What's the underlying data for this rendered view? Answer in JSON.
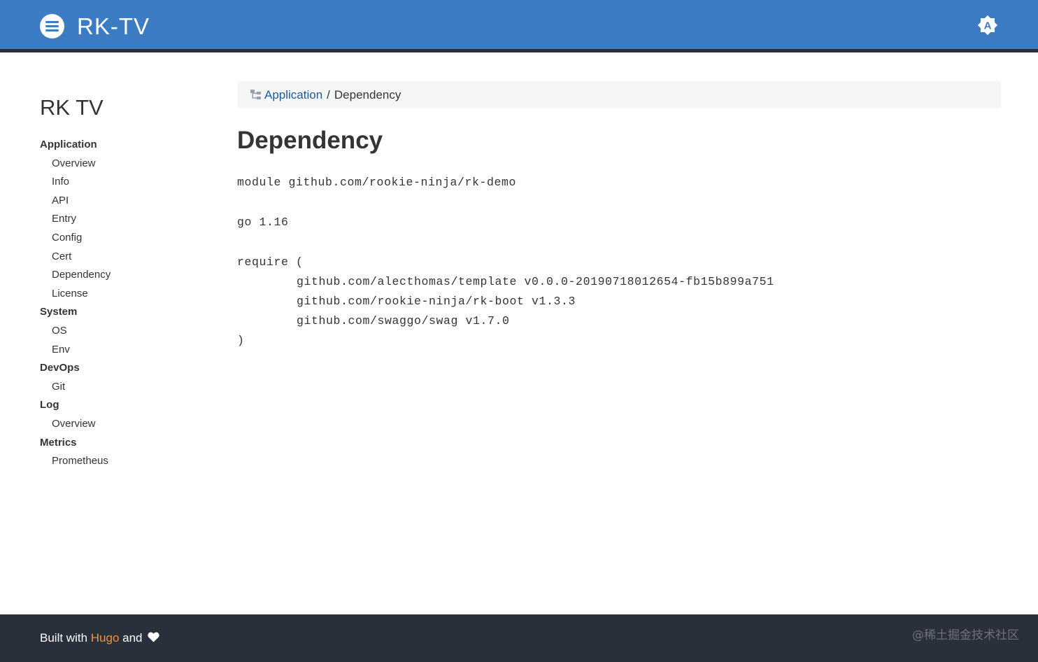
{
  "header": {
    "brand": "RK-TV",
    "menu_icon": "menu-lines-icon",
    "theme_icon": "brightness-auto-icon",
    "colors": {
      "bar": "#3c7cc5",
      "bar_border": "#2a2f3c"
    }
  },
  "sidebar": {
    "title": "RK TV",
    "sections": [
      {
        "label": "Application",
        "items": [
          "Overview",
          "Info",
          "API",
          "Entry",
          "Config",
          "Cert",
          "Dependency",
          "License"
        ]
      },
      {
        "label": "System",
        "items": [
          "OS",
          "Env"
        ]
      },
      {
        "label": "DevOps",
        "items": [
          "Git"
        ]
      },
      {
        "label": "Log",
        "items": [
          "Overview"
        ]
      },
      {
        "label": "Metrics",
        "items": [
          "Prometheus"
        ]
      }
    ]
  },
  "breadcrumb": {
    "icon": "sitemap-icon",
    "parent": "Application",
    "separator": "/",
    "current": "Dependency"
  },
  "page": {
    "title": "Dependency",
    "code": {
      "module_line": "module github.com/rookie-ninja/rk-demo",
      "go_line": "go 1.16",
      "require_open": "require (",
      "requires": [
        "github.com/alecthomas/template v0.0.0-20190718012654-fb15b899a751",
        "github.com/rookie-ninja/rk-boot v1.3.3",
        "github.com/swaggo/swag v1.7.0"
      ],
      "require_close": ")"
    }
  },
  "footer": {
    "built_with": "Built with",
    "hugo": "Hugo",
    "and": "and",
    "heart_icon": "heart-icon",
    "watermark": "@稀土掘金技术社区",
    "colors": {
      "background": "#2a2f3c",
      "link": "#f0952d"
    }
  }
}
